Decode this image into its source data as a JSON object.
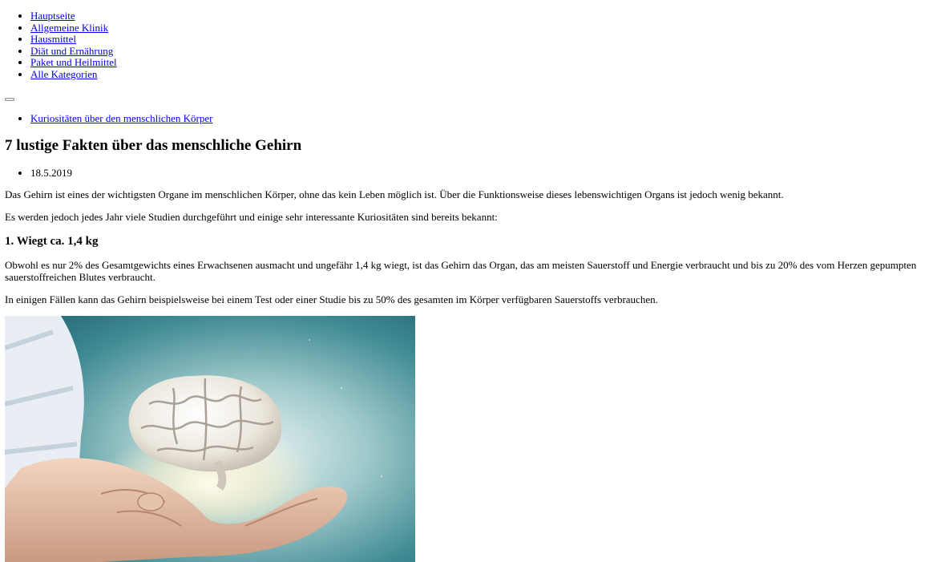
{
  "nav": {
    "items": [
      {
        "label": "Hauptseite"
      },
      {
        "label": "Allgemeine Klinik"
      },
      {
        "label": "Hausmittel"
      },
      {
        "label": "Diät und Ernährung"
      },
      {
        "label": "Paket und Heilmittel"
      },
      {
        "label": "Alle Kategorien"
      }
    ]
  },
  "menu_toggle": {
    "label": ""
  },
  "breadcrumb": {
    "label": "Kuriositäten über den menschlichen Körper"
  },
  "article": {
    "title": "7 lustige Fakten über das menschliche Gehirn",
    "date": "18.5.2019",
    "intro_1": "Das Gehirn ist eines der wichtigsten Organe im menschlichen Körper, ohne das kein Leben möglich ist. Über die Funktionsweise dieses lebenswichtigen Organs ist jedoch wenig bekannt.",
    "intro_2": "Es werden jedoch jedes Jahr viele Studien durchgeführt und einige sehr interessante Kuriositäten sind bereits bekannt:",
    "section_1_heading": "1. Wiegt ca. 1,4 kg",
    "section_1_p1": "Obwohl es nur 2% des Gesamtgewichts eines Erwachsenen ausmacht und ungefähr 1,4 kg wiegt, ist das Gehirn das Organ, das am meisten Sauerstoff und Energie verbraucht und bis zu 20% des vom Herzen gepumpten sauerstoffreichen Blutes verbraucht.",
    "section_1_p2": "In einigen Fällen kann das Gehirn beispielsweise bei einem Test oder einer Studie bis zu 50% des gesamten im Körper verfügbaren Sauerstoffs verbrauchen."
  },
  "colors": {
    "link": "#0000ee",
    "text": "#000000",
    "background": "#ffffff"
  }
}
